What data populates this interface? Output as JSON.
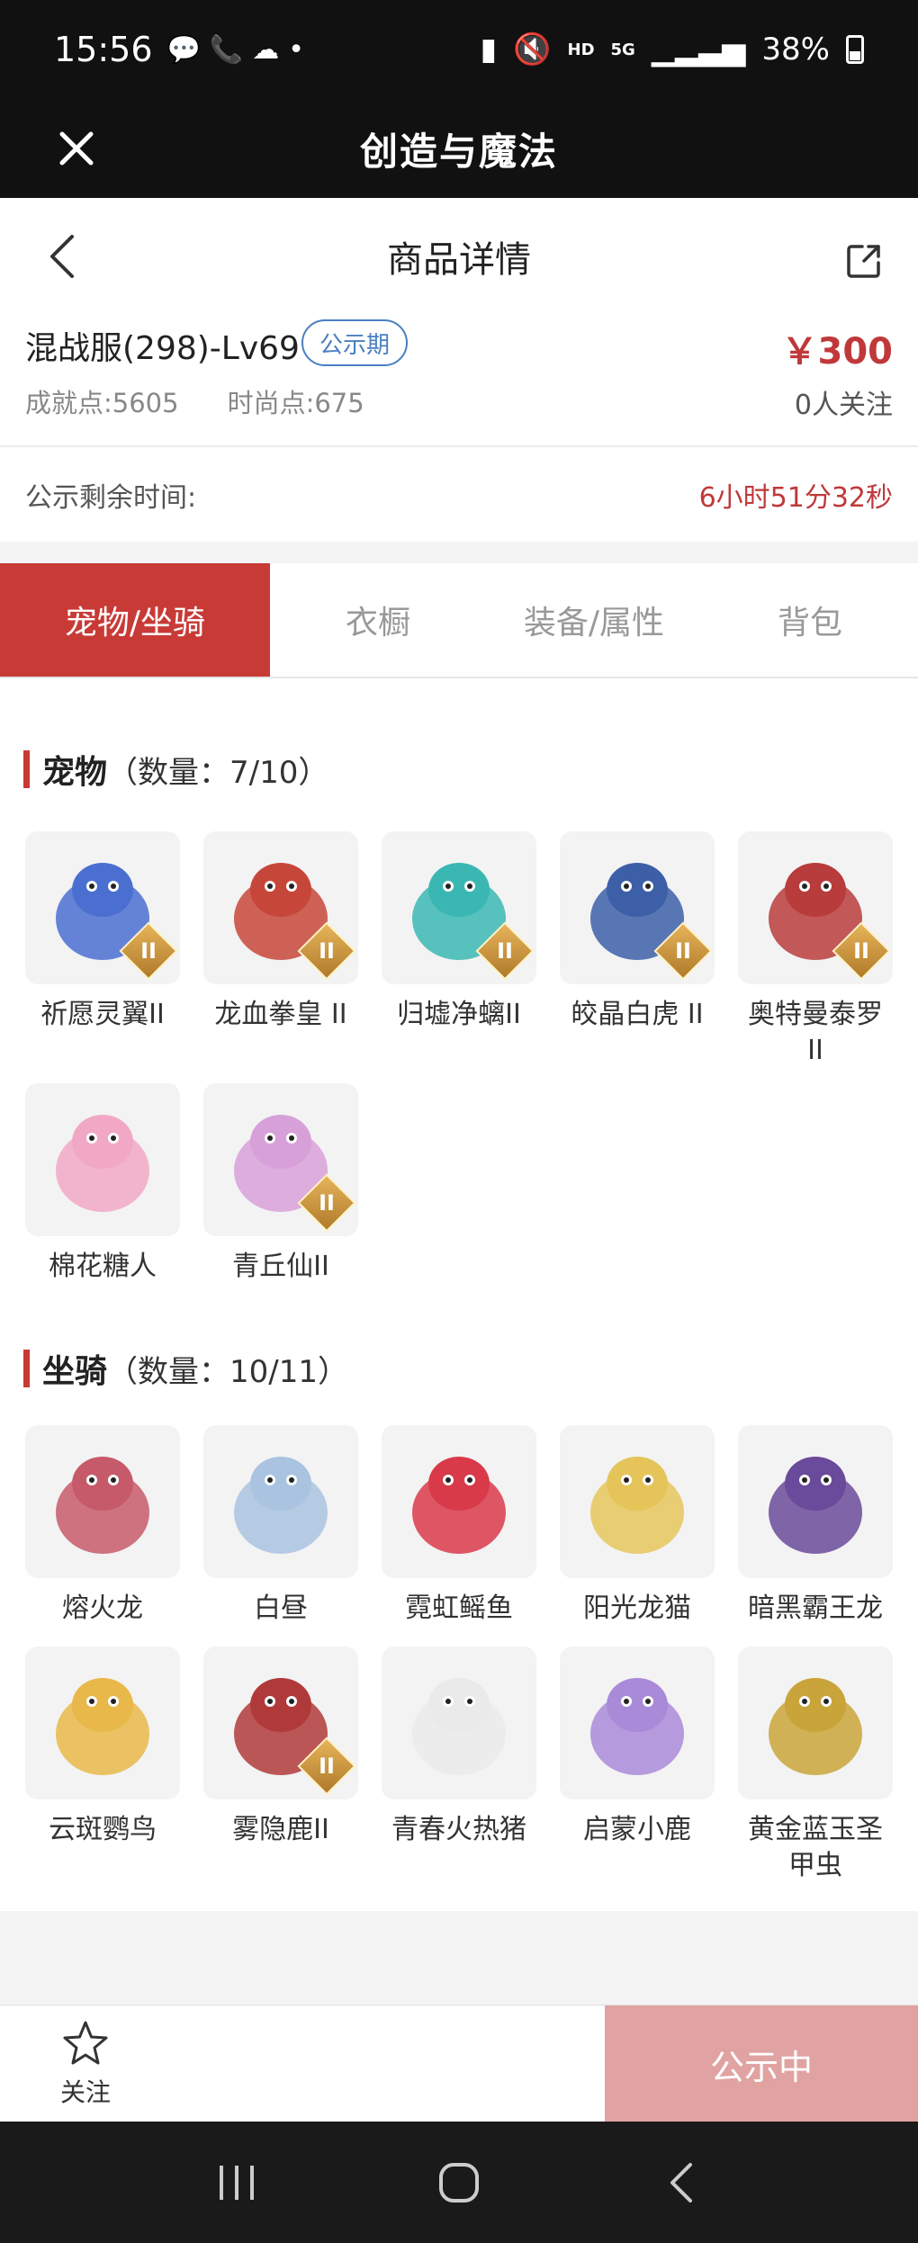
{
  "status": {
    "time": "15:56",
    "hd": "HD",
    "net": "5G",
    "battery": "38%"
  },
  "title_bar": {
    "title": "创造与魔法"
  },
  "nav": {
    "title": "商品详情"
  },
  "product": {
    "name": "混战服(298)-Lv69",
    "badge": "公示期",
    "price": "￥300",
    "achievement": "成就点:5605",
    "fashion": "时尚点:675",
    "followers": "0人关注"
  },
  "remaining": {
    "label": "公示剩余时间:",
    "value": "6小时51分32秒"
  },
  "tabs": [
    {
      "label": "宠物/坐骑"
    },
    {
      "label": "衣橱"
    },
    {
      "label": "装备/属性"
    },
    {
      "label": "背包"
    }
  ],
  "pets": {
    "title": "宠物",
    "count": "（数量：7/10）",
    "items": [
      {
        "name": "祈愿灵翼II",
        "rank": "II",
        "color": "#4b6fd0"
      },
      {
        "name": "龙血拳皇 II",
        "rank": "II",
        "color": "#c7463a"
      },
      {
        "name": "归墟净螭II",
        "rank": "II",
        "color": "#3bb7b3"
      },
      {
        "name": "皎晶白虎 II",
        "rank": "II",
        "color": "#3d5fa8"
      },
      {
        "name": "奥特曼泰罗\nII",
        "rank": "II",
        "color": "#b83c3c"
      },
      {
        "name": "棉花糖人",
        "rank": "",
        "color": "#f1a8c4"
      },
      {
        "name": "青丘仙II",
        "rank": "II",
        "color": "#d7a0d8"
      }
    ]
  },
  "mounts": {
    "title": "坐骑",
    "count": "（数量：10/11）",
    "items": [
      {
        "name": "熔火龙",
        "rank": "",
        "color": "#c75a6a"
      },
      {
        "name": "白昼",
        "rank": "",
        "color": "#a9c3e0"
      },
      {
        "name": "霓虹鳐鱼",
        "rank": "",
        "color": "#d93a4a"
      },
      {
        "name": "阳光龙猫",
        "rank": "",
        "color": "#e5c55a"
      },
      {
        "name": "暗黑霸王龙",
        "rank": "",
        "color": "#6a4a9a"
      },
      {
        "name": "云斑鹦鸟",
        "rank": "",
        "color": "#e8b84a"
      },
      {
        "name": "雾隐鹿II",
        "rank": "II",
        "color": "#b03a3a"
      },
      {
        "name": "青春火热猪",
        "rank": "",
        "color": "#eaeaea"
      },
      {
        "name": "启蒙小鹿",
        "rank": "",
        "color": "#a98ad8"
      },
      {
        "name": "黄金蓝玉圣\n甲虫",
        "rank": "",
        "color": "#c9a43a"
      }
    ]
  },
  "bottom": {
    "follow": "关注",
    "status": "公示中"
  }
}
